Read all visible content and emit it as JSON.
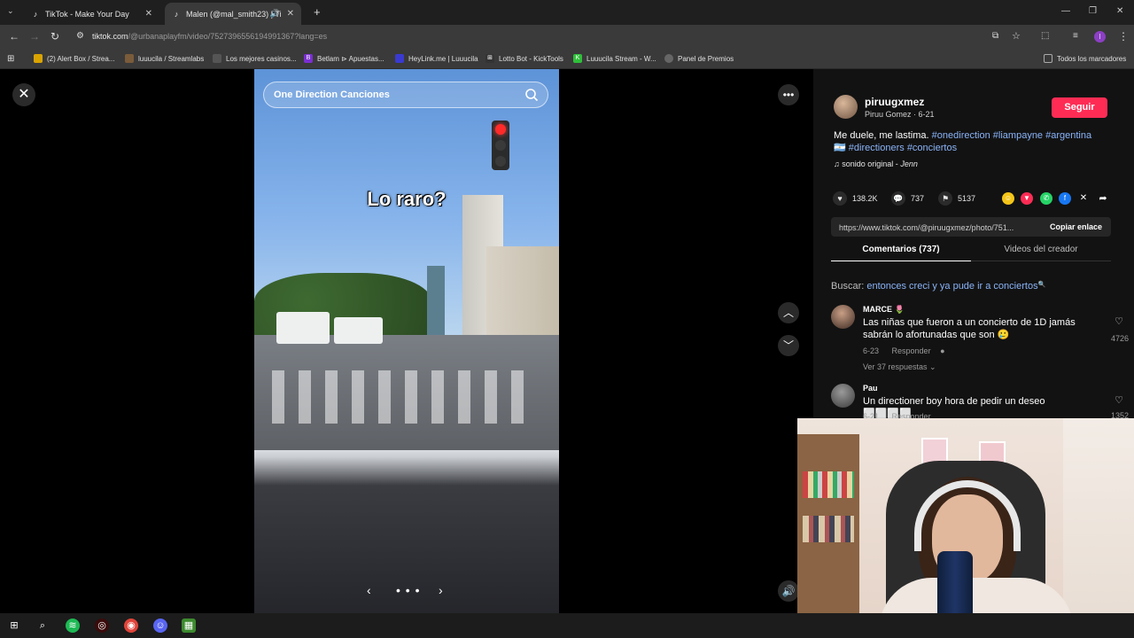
{
  "browser": {
    "tabs": [
      {
        "title": "TikTok - Make Your Day"
      },
      {
        "title": "Malen (@mal_smith23) | Ti"
      }
    ],
    "url_host": "tiktok.com",
    "url_path": "/@urbanaplayfm/video/7527396556194991367?lang=es",
    "bookmarks": [
      "(2) Alert Box / Strea...",
      "luuucila / Streamlabs",
      "Los mejores casinos...",
      "Betlam ⊳ Apuestas...",
      "HeyLink.me | Luuucila",
      "Lotto Bot - KickTools",
      "Luuucila Stream - W...",
      "Panel de Premios"
    ],
    "all_bookmarks": "Todos los marcadores"
  },
  "video": {
    "search_text": "One Direction Canciones",
    "caption": "Lo raro?",
    "dots": "• • •"
  },
  "post": {
    "username": "piruugxmez",
    "meta": "Piruu Gomez · 6-21",
    "follow": "Seguir",
    "desc_plain": "Me duele, me lastima.",
    "tags": [
      "#onedirection",
      "#liampayne",
      "#argentina🇦🇷",
      "#directioners",
      "#conciertos"
    ],
    "sound_label": "sonido original - ",
    "sound_author": "Jenn",
    "likes": "138.2K",
    "comments": "737",
    "saves": "5137",
    "link": "https://www.tiktok.com/@piruugxmez/photo/751...",
    "copy": "Copiar enlace",
    "tab_comments": "Comentarios (737)",
    "tab_videos": "Videos del creador",
    "search_prefix": "Buscar: ",
    "search_query": "entonces creci y ya pude ir a conciertos"
  },
  "comments": [
    {
      "user": "MARCE 🌷",
      "text": "Las niñas que fueron a un concierto de 1D jamás sabrán lo afortunadas que son 🥲",
      "date": "6-23",
      "reply": "Responder",
      "likes": "4726",
      "replies": "Ver 37 respuestas ⌄"
    },
    {
      "user": "Pau",
      "text": "Un directioner boy hora de pedir un deseo ⬜⬜⬜⬜",
      "date": "6-21",
      "reply": "Responder",
      "likes": "1352"
    }
  ],
  "colors": {
    "accent": "#fe2c55",
    "link": "#8ab4f8",
    "panel": "#121212"
  }
}
